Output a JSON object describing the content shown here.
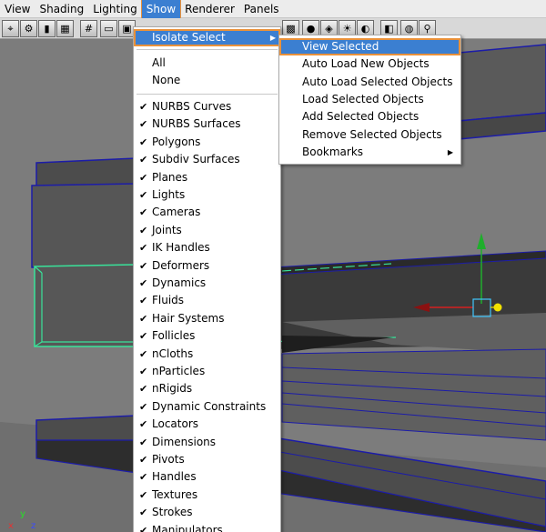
{
  "menubar": {
    "items": [
      {
        "label": "View"
      },
      {
        "label": "Shading"
      },
      {
        "label": "Lighting"
      },
      {
        "label": "Show"
      },
      {
        "label": "Renderer"
      },
      {
        "label": "Panels"
      }
    ],
    "active_index": 3
  },
  "toolbar": {
    "icons": [
      "select-camera-icon",
      "camera-attributes-icon",
      "bookmark-icon",
      "image-plane-icon",
      "grid-icon",
      "film-gate-icon",
      "resolution-gate-icon",
      "safe-action-icon",
      "wireframe-icon",
      "smooth-shade-icon",
      "textured-icon",
      "lights-icon",
      "shadows-icon",
      "isolate-select-icon",
      "xray-icon",
      "xray-joints-icon"
    ]
  },
  "show_menu": {
    "isolate_select": {
      "label": "Isolate Select",
      "highlighted": true,
      "has_submenu": true
    },
    "all_label": "All",
    "none_label": "None",
    "items": [
      {
        "label": "NURBS Curves",
        "checked": true
      },
      {
        "label": "NURBS Surfaces",
        "checked": true
      },
      {
        "label": "Polygons",
        "checked": true
      },
      {
        "label": "Subdiv Surfaces",
        "checked": true
      },
      {
        "label": "Planes",
        "checked": true
      },
      {
        "label": "Lights",
        "checked": true
      },
      {
        "label": "Cameras",
        "checked": true
      },
      {
        "label": "Joints",
        "checked": true
      },
      {
        "label": "IK Handles",
        "checked": true
      },
      {
        "label": "Deformers",
        "checked": true
      },
      {
        "label": "Dynamics",
        "checked": true
      },
      {
        "label": "Fluids",
        "checked": true
      },
      {
        "label": "Hair Systems",
        "checked": true
      },
      {
        "label": "Follicles",
        "checked": true
      },
      {
        "label": "nCloths",
        "checked": true
      },
      {
        "label": "nParticles",
        "checked": true
      },
      {
        "label": "nRigids",
        "checked": true
      },
      {
        "label": "Dynamic Constraints",
        "checked": true
      },
      {
        "label": "Locators",
        "checked": true
      },
      {
        "label": "Dimensions",
        "checked": true
      },
      {
        "label": "Pivots",
        "checked": true
      },
      {
        "label": "Handles",
        "checked": true
      },
      {
        "label": "Textures",
        "checked": true
      },
      {
        "label": "Strokes",
        "checked": true
      },
      {
        "label": "Manipulators",
        "checked": true
      }
    ]
  },
  "isolate_submenu": {
    "items": [
      {
        "label": "View Selected",
        "highlighted": true
      },
      {
        "label": "Auto Load New Objects"
      },
      {
        "label": "Auto Load Selected Objects"
      },
      {
        "label": "Load Selected Objects"
      },
      {
        "label": "Add Selected Objects"
      },
      {
        "label": "Remove Selected Objects"
      },
      {
        "label": "Bookmarks",
        "has_submenu": true
      }
    ]
  },
  "axis_indicator": {
    "x": "x",
    "y": "y",
    "z": "z"
  },
  "colors": {
    "menu_highlight": "#3b7fd1",
    "highlight_outline": "#e9913a",
    "wire_blue": "#1c1ca8",
    "selected_green": "#39e39a",
    "manip_y": "#1fae2c",
    "manip_x": "#d42020",
    "manip_z_handle": "#f2e200"
  }
}
